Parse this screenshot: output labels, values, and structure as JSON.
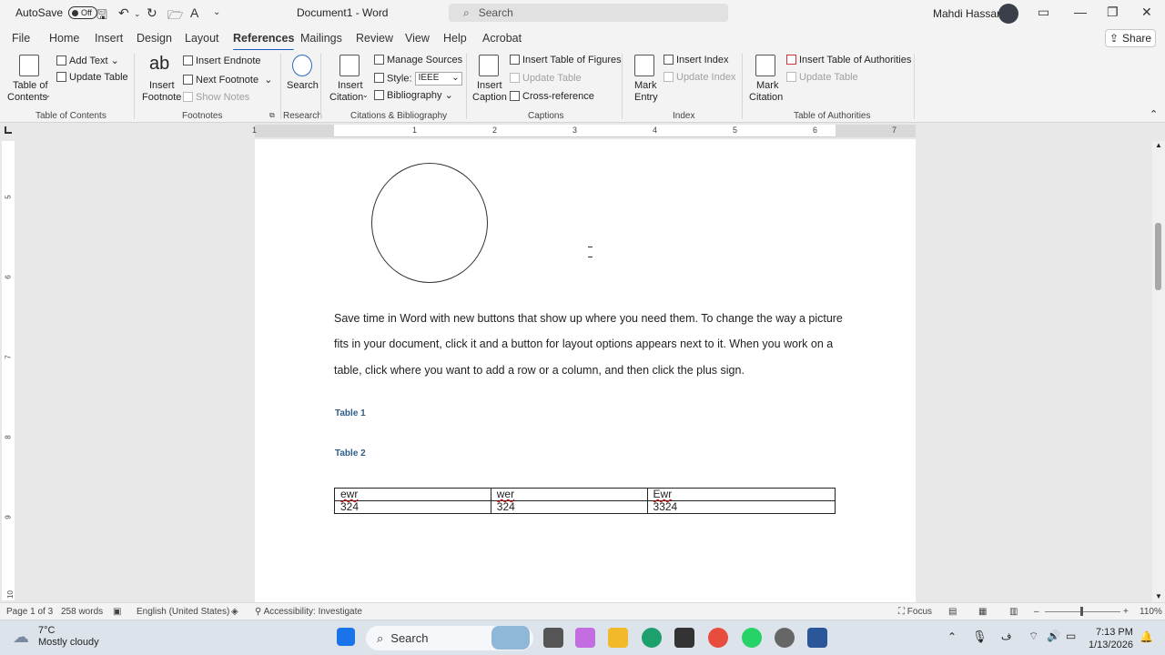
{
  "titlebar": {
    "autosave_label": "AutoSave",
    "autosave_state": "Off",
    "doc_title": "Document1 - Word",
    "search_placeholder": "Search",
    "user_name": "Mahdi Hassani"
  },
  "tabs": [
    "File",
    "Home",
    "Insert",
    "Design",
    "Layout",
    "References",
    "Mailings",
    "Review",
    "View",
    "Help",
    "Acrobat"
  ],
  "active_tab": "References",
  "share_label": "Share",
  "ribbon": {
    "toc": {
      "big_label_1": "Table of",
      "big_label_2": "Contents",
      "add_text": "Add Text",
      "update_table": "Update Table",
      "group": "Table of Contents"
    },
    "footnotes": {
      "insert_footnote_1": "Insert",
      "insert_footnote_2": "Footnote",
      "insert_endnote": "Insert Endnote",
      "next_footnote": "Next Footnote",
      "show_notes": "Show Notes",
      "group": "Footnotes",
      "icon_text": "ab"
    },
    "research": {
      "search": "Search",
      "group": "Research"
    },
    "citations": {
      "insert_citation_1": "Insert",
      "insert_citation_2": "Citation",
      "manage_sources": "Manage Sources",
      "style_label": "Style:",
      "style_value": "IEEE",
      "bibliography": "Bibliography",
      "group": "Citations & Bibliography"
    },
    "captions": {
      "insert_caption_1": "Insert",
      "insert_caption_2": "Caption",
      "insert_table_of_figures": "Insert Table of Figures",
      "update_table": "Update Table",
      "cross_reference": "Cross-reference",
      "group": "Captions"
    },
    "index": {
      "mark_entry_1": "Mark",
      "mark_entry_2": "Entry",
      "insert_index": "Insert Index",
      "update_index": "Update Index",
      "group": "Index"
    },
    "authorities": {
      "mark_citation_1": "Mark",
      "mark_citation_2": "Citation",
      "insert_toa": "Insert Table of Authorities",
      "update_table": "Update Table",
      "group": "Table of Authorities"
    }
  },
  "ruler": {
    "h_numbers": [
      "1",
      "1",
      "2",
      "3",
      "4",
      "5",
      "6",
      "7"
    ],
    "v_numbers": [
      "5",
      "6",
      "7",
      "8",
      "9",
      "10"
    ]
  },
  "document": {
    "paragraph": "Save time in Word with new buttons that show up where you need them. To change the way a picture fits in your document, click it and a button for layout options appears next to it. When you work on a table, click where you want to add a row or a column, and then click the plus sign.",
    "caption_1": "Table 1",
    "caption_2": "Table 2",
    "table": [
      [
        "ewr",
        "wer",
        "Ewr"
      ],
      [
        "324",
        "324",
        "3324"
      ]
    ]
  },
  "status": {
    "page": "Page 1 of 3",
    "words": "258 words",
    "language": "English (United States)",
    "accessibility": "Accessibility: Investigate",
    "focus": "Focus",
    "zoom": "110%"
  },
  "taskbar": {
    "temperature": "7°C",
    "weather": "Mostly cloudy",
    "search": "Search",
    "time": "7:13 PM",
    "date": "1/13/2026"
  }
}
